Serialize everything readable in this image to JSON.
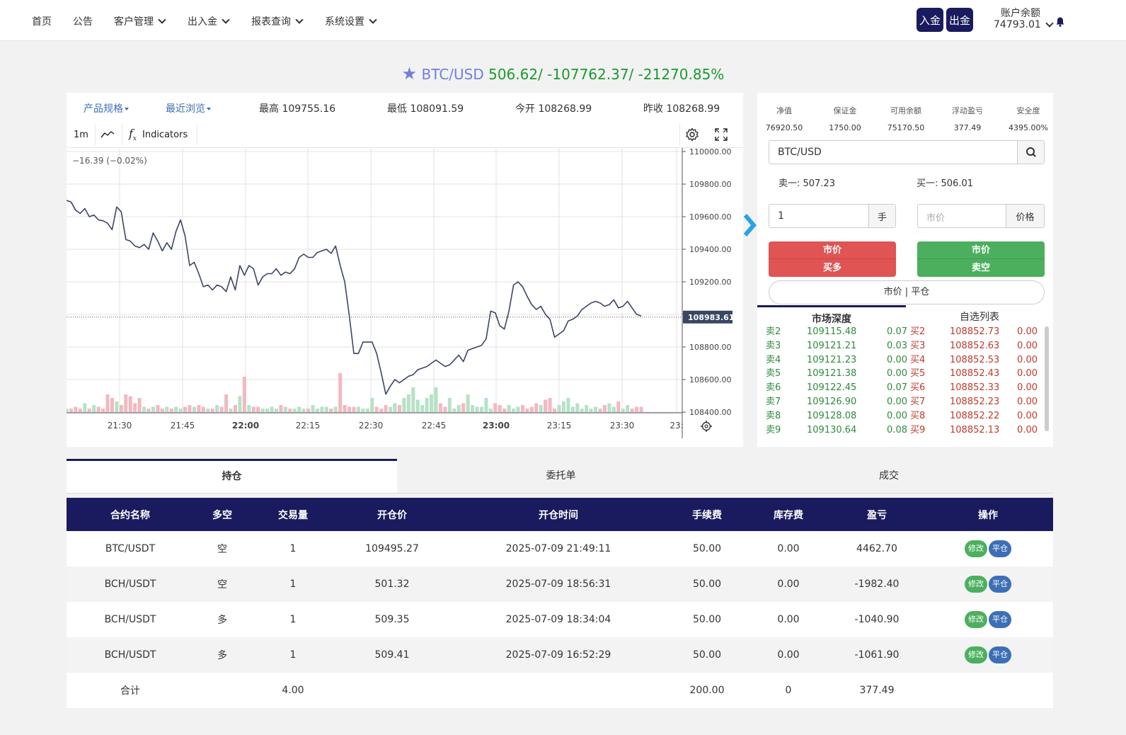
{
  "nav": {
    "home": "首页",
    "notice": "公告",
    "customers": "客户管理",
    "funds": "出入金",
    "reports": "报表查询",
    "settings": "系统设置",
    "deposit": "入金",
    "withdraw": "出金",
    "balance_label": "账户余额",
    "balance_value": "74793.01"
  },
  "ticker": {
    "symbol": "BTC/USD",
    "values": "506.62/ -107762.37/ -21270.85%"
  },
  "chart_info": {
    "spec": "产品规格",
    "recent": "最近浏览",
    "high": "最高 109755.16",
    "low": "最低 108091.59",
    "open": "今开 108268.99",
    "prev_close": "昨收 108268.99"
  },
  "toolbar": {
    "interval": "1m",
    "indicators": "Indicators"
  },
  "chart_data": {
    "type": "line",
    "change_label": "−16.39 (−0.02%)",
    "last_price_label": "108983.61",
    "last_price": 108983.61,
    "ylim": [
      108400,
      110000
    ],
    "y_ticks": [
      "110000.00",
      "109800.00",
      "109600.00",
      "109400.00",
      "109200.00",
      "109000.00",
      "108800.00",
      "108600.00",
      "108400.00"
    ],
    "x_ticks": [
      "21:30",
      "21:45",
      "22:00",
      "22:15",
      "22:30",
      "22:45",
      "23:00",
      "23:15",
      "23:30",
      "23:"
    ],
    "x_ticks_bold": [
      false,
      false,
      true,
      false,
      false,
      false,
      true,
      false,
      false,
      false
    ],
    "series": [
      {
        "values": [
          109700,
          109690,
          109640,
          109620,
          109650,
          109600,
          109610,
          109580,
          109575,
          109560,
          109520,
          109660,
          109630,
          109460,
          109450,
          109420,
          109410,
          109430,
          109400,
          109500,
          109450,
          109390,
          109440,
          109400,
          109510,
          109580,
          109480,
          109300,
          109320,
          109250,
          109170,
          109180,
          109150,
          109180,
          109170,
          109140,
          109230,
          109150,
          109300,
          109240,
          109300,
          109280,
          109180,
          109230,
          109250,
          109250,
          109280,
          109240,
          109260,
          109250,
          109280,
          109350,
          109370,
          109350,
          109350,
          109380,
          109390,
          109400,
          109375,
          109420,
          109300,
          109200,
          108990,
          108760,
          108760,
          108830,
          108830,
          108830,
          108760,
          108640,
          108510,
          108560,
          108600,
          108580,
          108600,
          108620,
          108630,
          108660,
          108670,
          108680,
          108700,
          108720,
          108700,
          108680,
          108690,
          108720,
          108750,
          108710,
          108780,
          108790,
          108800,
          108810,
          108850,
          109020,
          109010,
          108930,
          108910,
          109020,
          109180,
          109200,
          109170,
          109110,
          109060,
          109030,
          109050,
          109000,
          108970,
          108860,
          108880,
          108900,
          108960,
          108970,
          108990,
          109030,
          109050,
          109070,
          109080,
          109070,
          109050,
          109060,
          109090,
          109040,
          109050,
          109080,
          109040,
          109000,
          108990
        ]
      },
      {
        "name": "volume",
        "values": [
          2,
          2,
          3,
          2,
          5,
          2,
          4,
          3,
          2,
          10,
          8,
          6,
          4,
          10,
          9,
          5,
          8,
          3,
          2,
          3,
          4,
          2,
          3,
          2,
          3,
          2,
          3,
          4,
          3,
          4,
          3,
          2,
          2,
          4,
          3,
          10,
          2,
          4,
          9,
          20,
          4,
          3,
          3,
          2,
          2,
          3,
          2,
          4,
          3,
          2,
          2,
          3,
          2,
          2,
          4,
          2,
          3,
          3,
          2,
          3,
          22,
          4,
          3,
          3,
          3,
          2,
          2,
          8,
          3,
          2,
          4,
          3,
          5,
          4,
          8,
          10,
          14,
          7,
          4,
          8,
          10,
          14,
          5,
          3,
          8,
          2,
          4,
          5,
          10,
          4,
          3,
          3,
          8,
          2,
          5,
          4,
          2,
          4,
          2,
          3,
          4,
          2,
          3,
          5,
          4,
          7,
          8,
          2,
          4,
          6,
          8,
          3,
          5,
          2,
          4,
          2,
          3,
          2,
          4,
          5,
          3,
          6,
          2,
          4,
          2,
          3,
          3
        ]
      }
    ]
  },
  "account": {
    "labels": [
      "净值",
      "保证金",
      "可用余额",
      "浮动盈亏",
      "安全度"
    ],
    "values": [
      "76920.50",
      "1750.00",
      "75170.50",
      "377.49",
      "4395.00%"
    ]
  },
  "order": {
    "symbol": "BTC/USD",
    "ask": "卖一: 507.23",
    "bid": "买一: 506.01",
    "qty": "1",
    "qty_unit": "手",
    "price_placeholder": "市价",
    "price_unit": "价格",
    "buy_top": "市价",
    "buy_bottom": "买多",
    "sell_top": "市价",
    "sell_bottom": "卖空",
    "close_all": "市价 | 平仓"
  },
  "depth": {
    "tab_market": "市场深度",
    "tab_watch": "自选列表",
    "asks": [
      [
        "卖2",
        "109115.48",
        "0.07"
      ],
      [
        "卖3",
        "109121.21",
        "0.03"
      ],
      [
        "卖4",
        "109121.23",
        "0.00"
      ],
      [
        "卖5",
        "109121.38",
        "0.00"
      ],
      [
        "卖6",
        "109122.45",
        "0.07"
      ],
      [
        "卖7",
        "109126.90",
        "0.00"
      ],
      [
        "卖8",
        "109128.08",
        "0.00"
      ],
      [
        "卖9",
        "109130.64",
        "0.08"
      ]
    ],
    "bids": [
      [
        "买2",
        "108852.73",
        "0.00"
      ],
      [
        "买3",
        "108852.63",
        "0.00"
      ],
      [
        "买4",
        "108852.53",
        "0.00"
      ],
      [
        "买5",
        "108852.43",
        "0.00"
      ],
      [
        "买6",
        "108852.33",
        "0.00"
      ],
      [
        "买7",
        "108852.23",
        "0.00"
      ],
      [
        "买8",
        "108852.22",
        "0.00"
      ],
      [
        "买9",
        "108852.13",
        "0.00"
      ]
    ]
  },
  "tabs": {
    "positions": "持仓",
    "orders": "委托单",
    "trades": "成交"
  },
  "table": {
    "headers": [
      "合约名称",
      "多空",
      "交易量",
      "开仓价",
      "开仓时间",
      "手续费",
      "库存费",
      "盈亏",
      "操作"
    ],
    "rows": [
      [
        "BTC/USDT",
        "空",
        "1",
        "109495.27",
        "2025-07-09 21:49:11",
        "50.00",
        "0.00",
        "4462.70"
      ],
      [
        "BCH/USDT",
        "空",
        "1",
        "501.32",
        "2025-07-09 18:56:31",
        "50.00",
        "0.00",
        "-1982.40"
      ],
      [
        "BCH/USDT",
        "多",
        "1",
        "509.35",
        "2025-07-09 18:34:04",
        "50.00",
        "0.00",
        "-1040.90"
      ],
      [
        "BCH/USDT",
        "多",
        "1",
        "509.41",
        "2025-07-09 16:52:29",
        "50.00",
        "0.00",
        "-1061.90"
      ]
    ],
    "modify_label": "修改",
    "close_label": "平仓",
    "total": {
      "label": "合计",
      "volume": "4.00",
      "fee": "200.00",
      "storage": "0",
      "pnl": "377.49"
    }
  }
}
